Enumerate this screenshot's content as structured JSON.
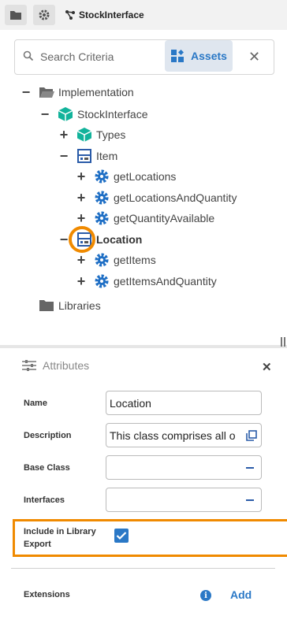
{
  "tab": {
    "title": "StockInterface"
  },
  "search": {
    "placeholder": "Search Criteria",
    "assets_label": "Assets",
    "close_glyph": "✕"
  },
  "tree": {
    "implementation": "Implementation",
    "stockinterface": "StockInterface",
    "types": "Types",
    "item": "Item",
    "get_locations": "getLocations",
    "get_locations_qty": "getLocationsAndQuantity",
    "get_qty_available": "getQuantityAvailable",
    "location": "Location",
    "get_items": "getItems",
    "get_items_qty": "getItemsAndQuantity",
    "libraries": "Libraries"
  },
  "attributes": {
    "title": "Attributes",
    "close_glyph": "✕",
    "name_label": "Name",
    "name_value": "Location",
    "description_label": "Description",
    "description_value": "This class comprises all o",
    "base_class_label": "Base Class",
    "interfaces_label": "Interfaces",
    "include_label_line1": "Include in Library",
    "include_label_line2": "Export",
    "include_checked": true,
    "extensions_label": "Extensions",
    "info_glyph": "i",
    "add_label": "Add"
  },
  "colors": {
    "accent": "#2a78c6",
    "highlight": "#f08a00",
    "teal": "#12b39b",
    "gear": "#1f6fc5"
  }
}
